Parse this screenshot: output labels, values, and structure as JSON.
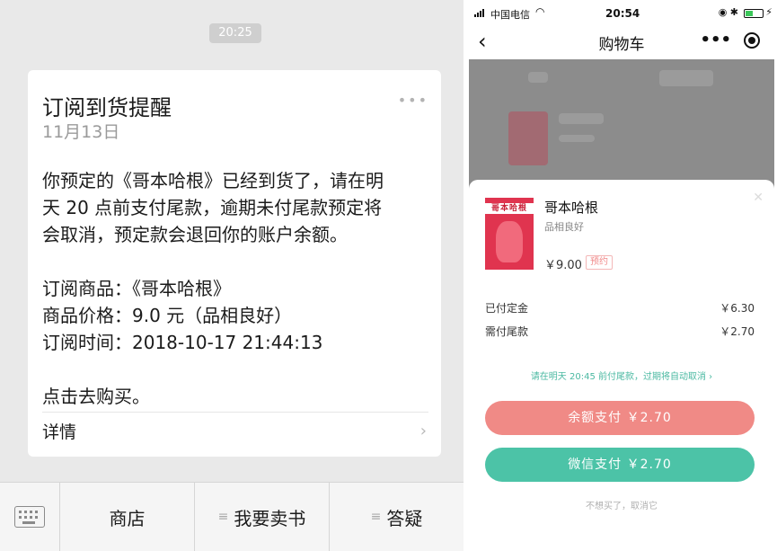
{
  "left": {
    "time_chip": "20:25",
    "card": {
      "title": "订阅到货提醒",
      "date": "11月13日",
      "more": "•••",
      "body_lines": [
        "你预定的《哥本哈根》已经到货了，请在明",
        "天 20 点前支付尾款，逾期未付尾款预定将",
        "会取消，预定款会退回你的账户余额。"
      ],
      "item_line": "订阅商品：《哥本哈根》",
      "price_line": "商品价格：9.0 元（品相良好）",
      "time_line": "订阅时间：2018-10-17 21:44:13",
      "cta_line": "点击去购买。",
      "detail_label": "详情",
      "chevron": "›"
    },
    "menu": {
      "keyboard_icon": "keyboard-icon",
      "items": [
        "商店",
        "我要卖书",
        "答疑"
      ],
      "list_icon": "≡"
    }
  },
  "right": {
    "status": {
      "carrier": "中国电信",
      "wifi": "wifi-icon",
      "clock": "20:54",
      "sys_icons": "◉ ✱",
      "bolt": "⚡"
    },
    "nav": {
      "back": "‹",
      "title": "购物车",
      "more": "•••"
    },
    "sheet": {
      "close": "✕",
      "cover_title": "哥本哈根",
      "book_name": "哥本哈根",
      "condition": "品相良好",
      "price": "￥9.00",
      "tag": "预约",
      "paid_label": "已付定金",
      "paid_value": "￥6.30",
      "due_label": "需付尾款",
      "due_value": "￥2.70",
      "deadline": "请在明天 20:45 前付尾款，过期将自动取消 ›",
      "btn_balance": "余额支付 ￥2.70",
      "btn_wechat": "微信支付 ￥2.70",
      "footer": "不想买了，取消它"
    }
  },
  "colors": {
    "accent_green": "#4cc3a7",
    "accent_red": "#f08a86",
    "cover_red": "#e0344f"
  }
}
